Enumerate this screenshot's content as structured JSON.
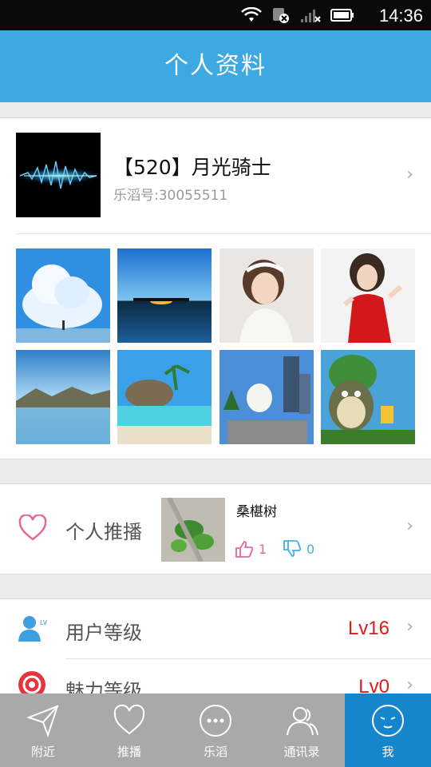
{
  "status_bar": {
    "time": "14:36"
  },
  "header": {
    "title": "个人资料"
  },
  "profile": {
    "nickname": "【520】月光骑士",
    "user_id": "乐滔号:30055511"
  },
  "feed": {
    "label": "个人推播",
    "author": "桑椹树",
    "likes": "1",
    "dislikes": "0"
  },
  "rows": [
    {
      "label": "用户等级",
      "value": "Lv16"
    },
    {
      "label": "魅力等级",
      "value": "Lv0"
    }
  ],
  "tabs": [
    {
      "label": "附近",
      "icon": "send-icon"
    },
    {
      "label": "推播",
      "icon": "heart-icon"
    },
    {
      "label": "乐滔",
      "icon": "chat-bubble-icon"
    },
    {
      "label": "通讯录",
      "icon": "contacts-icon"
    },
    {
      "label": "我",
      "icon": "face-icon"
    }
  ],
  "colors": {
    "header": "#3ca9e2",
    "active_tab": "#1586cc",
    "tab_bar": "#a9a9a9",
    "level_red": "#e01a1a"
  }
}
